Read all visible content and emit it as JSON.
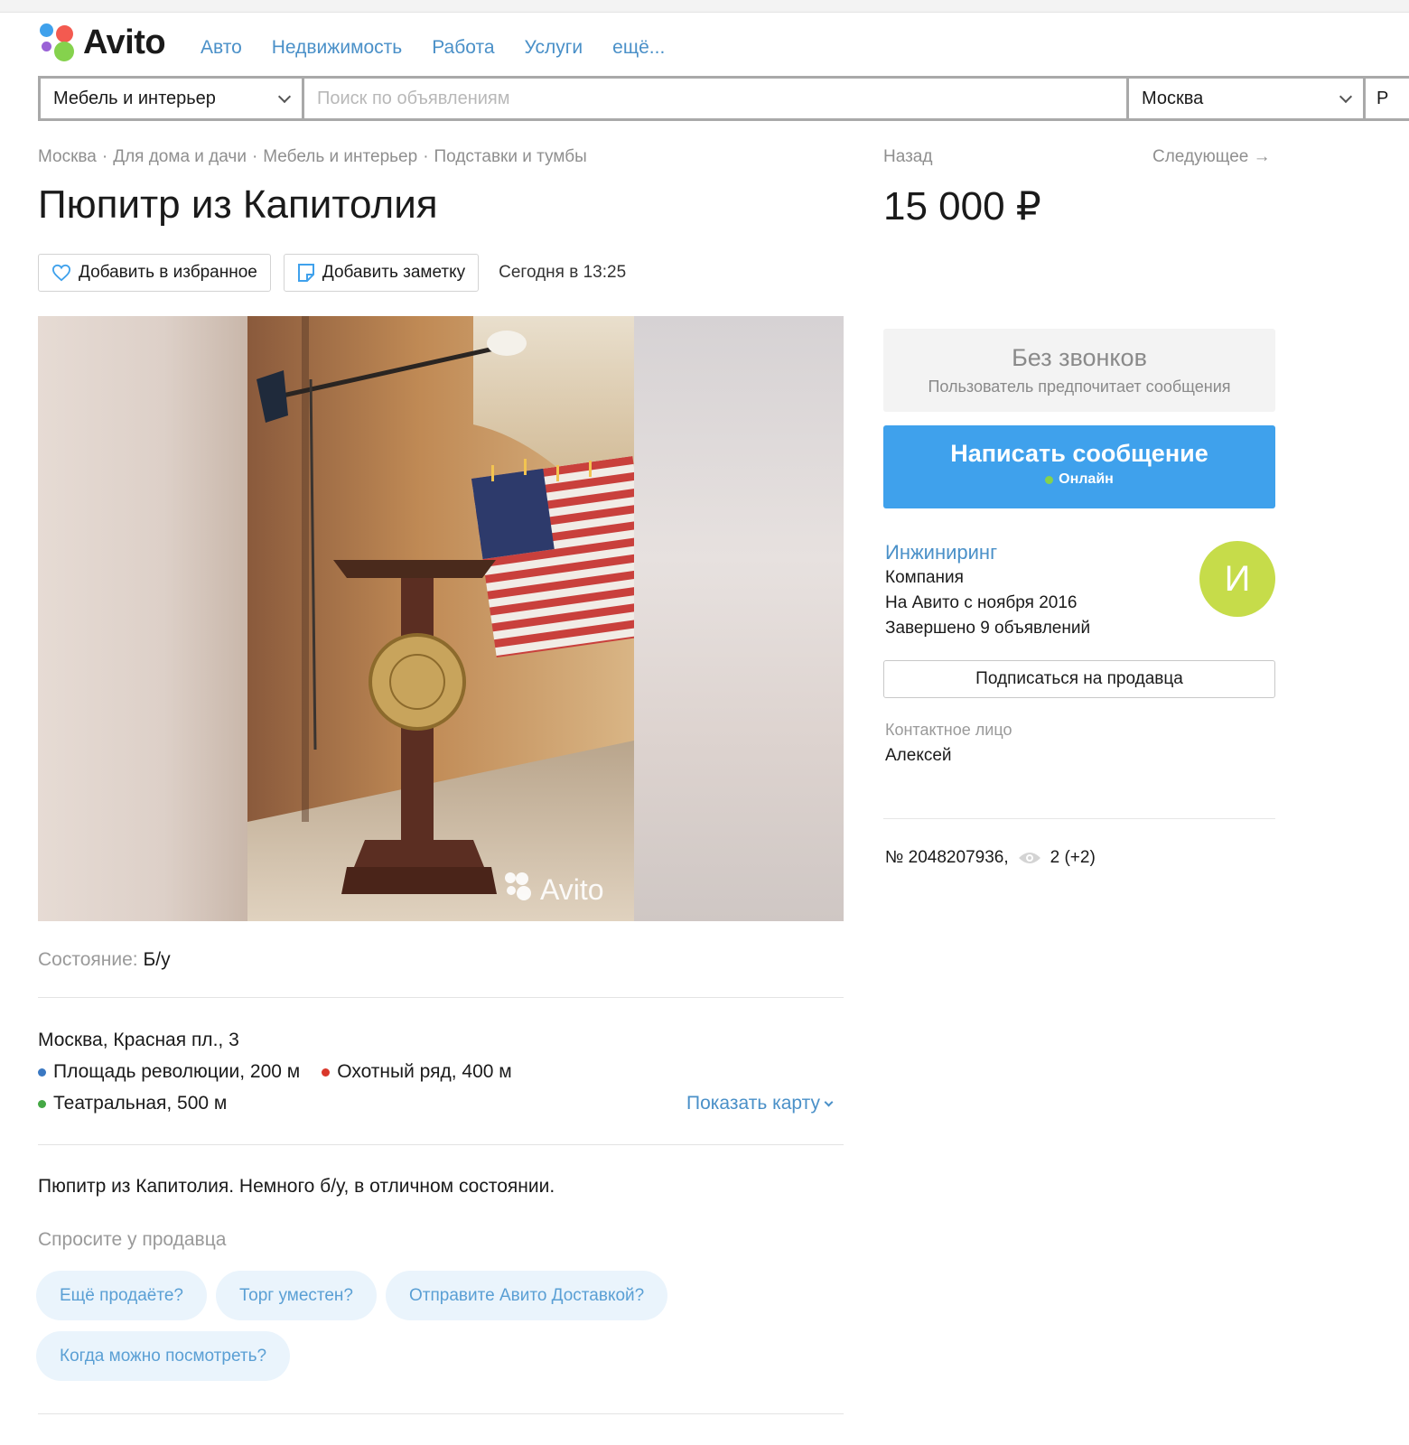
{
  "header": {
    "logo_text": "Avito",
    "nav": [
      "Авто",
      "Недвижимость",
      "Работа",
      "Услуги",
      "ещё..."
    ]
  },
  "search": {
    "category": "Мебель и интерьер",
    "placeholder": "Поиск по объявлениям",
    "city": "Москва",
    "extra": "Р"
  },
  "breadcrumb": [
    "Москва",
    "Для дома и дачи",
    "Мебель и интерьер",
    "Подставки и тумбы"
  ],
  "listing": {
    "title": "Пюпитр из Капитолия",
    "favorite_label": "Добавить в избранное",
    "note_label": "Добавить заметку",
    "date": "Сегодня в 13:25",
    "photo_watermark": "Avito",
    "condition_label": "Состояние:",
    "condition_value": "Б/у",
    "address": "Москва, Красная пл., 3",
    "metro": [
      {
        "name": "Площадь революции, 200 м",
        "color": "#3a78c2"
      },
      {
        "name": "Охотный ряд, 400 м",
        "color": "#d9372b"
      },
      {
        "name": "Театральная, 500 м",
        "color": "#45a845"
      }
    ],
    "show_map": "Показать карту",
    "description": "Пюпитр из Капитолия. Немного б/у, в отличном состоянии.",
    "ask_label": "Спросите у продавца",
    "ask_chips": [
      "Ещё продаёте?",
      "Торг уместен?",
      "Отправите Авито Доставкой?",
      "Когда можно посмотреть?"
    ]
  },
  "sidebar": {
    "back": "Назад",
    "next": "Следующее →",
    "price": "15 000 ₽",
    "no_calls_title": "Без звонков",
    "no_calls_sub": "Пользователь предпочитает сообщения",
    "message_button": "Написать сообщение",
    "online": "Онлайн",
    "seller_name": "Инжиниринг",
    "seller_type": "Компания",
    "seller_since": "На Авито с ноября 2016",
    "seller_completed": "Завершено 9 объявлений",
    "avatar_letter": "И",
    "subscribe": "Подписаться на продавца",
    "contact_label": "Контактное лицо",
    "contact_name": "Алексей",
    "ad_number": "№ 2048207936,",
    "views": "2 (+2)"
  },
  "colors": {
    "accent_blue": "#3fa1ec",
    "link_blue": "#4a90c8",
    "avatar": "#c6dc4a",
    "chip_bg": "#eaf4fc"
  }
}
